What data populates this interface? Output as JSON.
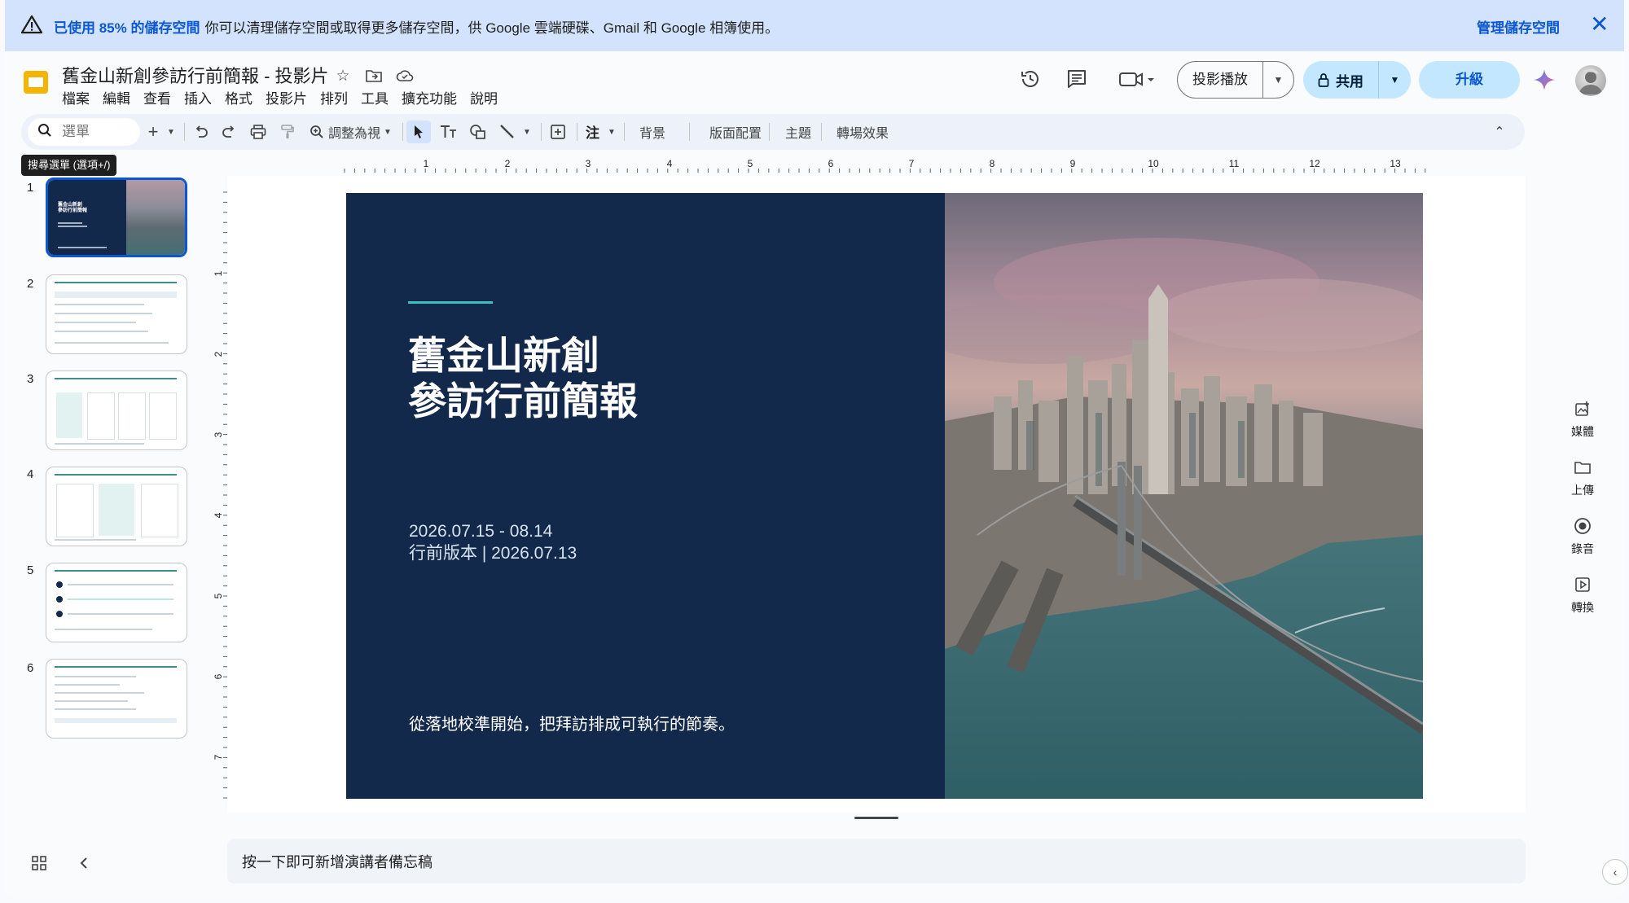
{
  "banner": {
    "bold_text": "已使用 85% 的儲存空間",
    "text": "你可以清理儲存空間或取得更多儲存空間，供 Google 雲端硬碟、Gmail 和 Google 相簿使用。",
    "manage_label": "管理儲存空間",
    "close_label": "✕"
  },
  "doc": {
    "title": "舊金山新創參訪行前簡報 - 投影片"
  },
  "menu": [
    "檔案",
    "編輯",
    "查看",
    "插入",
    "格式",
    "投影片",
    "排列",
    "工具",
    "擴充功能",
    "說明"
  ],
  "header": {
    "present_label": "投影播放",
    "share_label": "共用",
    "upgrade_label": "升級"
  },
  "toolbar": {
    "search_placeholder": "選單",
    "zoom_label": "調整為視",
    "background_label": "背景",
    "layout_label": "版面配置",
    "theme_label": "主題",
    "transition_label": "轉場效果",
    "tooltip": "搜尋選單 (選項+/)"
  },
  "rulers": {
    "horizontal": [
      "1",
      "2",
      "3",
      "4",
      "5",
      "6",
      "7",
      "8",
      "9",
      "10",
      "11",
      "12",
      "13"
    ],
    "vertical": [
      "1",
      "2",
      "3",
      "4",
      "5",
      "6",
      "7"
    ]
  },
  "filmstrip": {
    "numbers": [
      "1",
      "2",
      "3",
      "4",
      "5",
      "6"
    ]
  },
  "slide": {
    "title_line1": "舊金山新創",
    "title_line2": "參訪行前簡報",
    "dates": "2026.07.15 - 08.14",
    "version": "行前版本 | 2026.07.13",
    "tagline": "從落地校準開始，把拜訪排成可執行的節奏。"
  },
  "notes": {
    "placeholder": "按一下即可新增演講者備忘稿"
  },
  "side_panel": {
    "media": "媒體",
    "upload": "上傳",
    "record": "錄音",
    "convert": "轉換"
  },
  "colors": {
    "banner_bg": "#d3e3fd",
    "accent_blue": "#0b57d0",
    "slide_bg": "#13294b",
    "slide_accent": "#3dbfc2",
    "share_bg": "#c2e7ff"
  }
}
